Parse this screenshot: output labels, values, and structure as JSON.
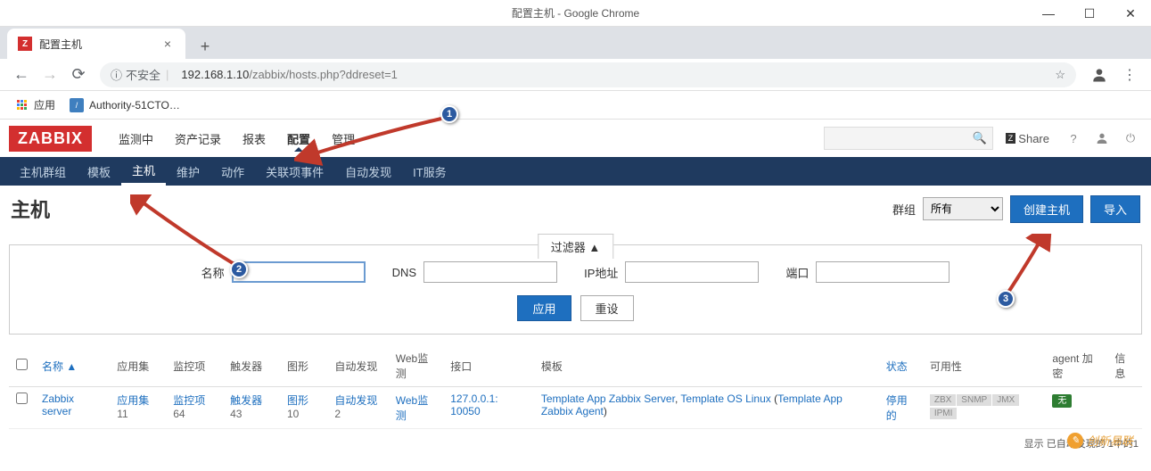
{
  "window": {
    "title_full": "配置主机 - Google Chrome"
  },
  "browser": {
    "tab_title": "配置主机",
    "insecure_label": "不安全",
    "url_host": "192.168.1.10",
    "url_path": "/zabbix/hosts.php?ddreset=1",
    "bookmarks": {
      "apps_label": "应用",
      "item1": "Authority-51CTO…"
    }
  },
  "zabbix": {
    "logo": "ZABBIX",
    "main_nav": [
      "监测中",
      "资产记录",
      "报表",
      "配置",
      "管理"
    ],
    "main_nav_active": "配置",
    "header_right": {
      "share": "Share"
    },
    "sub_nav": [
      "主机群组",
      "模板",
      "主机",
      "维护",
      "动作",
      "关联项事件",
      "自动发现",
      "IT服务"
    ],
    "sub_nav_active": "主机",
    "page": {
      "title": "主机",
      "group_label": "群组",
      "group_value": "所有",
      "create_btn": "创建主机",
      "import_btn": "导入"
    },
    "filter": {
      "tab_label": "过滤器 ▲",
      "name_label": "名称",
      "dns_label": "DNS",
      "ip_label": "IP地址",
      "port_label": "端口",
      "apply_btn": "应用",
      "reset_btn": "重设"
    },
    "table": {
      "headers": {
        "name": "名称 ▲",
        "applications": "应用集",
        "items": "监控项",
        "triggers": "触发器",
        "graphs": "图形",
        "discovery": "自动发现",
        "web": "Web监测",
        "interface": "接口",
        "templates": "模板",
        "status": "状态",
        "availability": "可用性",
        "agent_enc": "agent 加密",
        "info": "信息"
      },
      "rows": [
        {
          "name": "Zabbix server",
          "applications_label": "应用集",
          "applications_count": "11",
          "items_label": "监控项",
          "items_count": "64",
          "triggers_label": "触发器",
          "triggers_count": "43",
          "graphs_label": "图形",
          "graphs_count": "10",
          "discovery_label": "自动发现",
          "discovery_count": "2",
          "web_label": "Web监测",
          "interface": "127.0.0.1: 10050",
          "templates_1": "Template App Zabbix Server",
          "templates_sep1": ", ",
          "templates_2": "Template OS Linux",
          "templates_paren_open": " (",
          "templates_3": "Template App Zabbix Agent",
          "templates_paren_close": ")",
          "status": "停用的",
          "avail": [
            "ZBX",
            "SNMP",
            "JMX",
            "IPMI"
          ],
          "enc": "无"
        }
      ],
      "footer": "显示 已自动发现的 1中的1"
    }
  },
  "annotations": {
    "n1": "1",
    "n2": "2",
    "n3": "3"
  },
  "watermark": "创新易联"
}
